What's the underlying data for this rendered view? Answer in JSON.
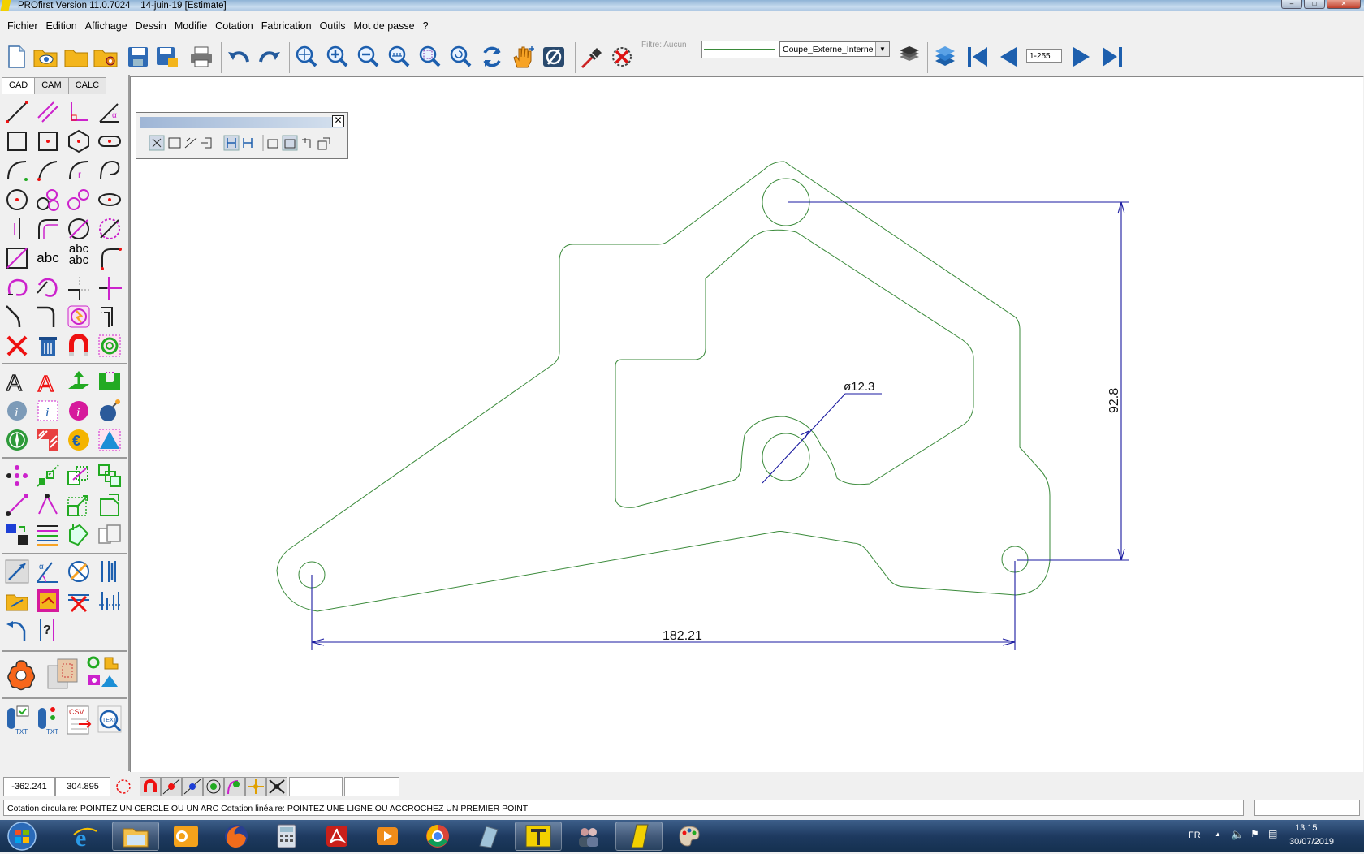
{
  "titlebar": {
    "app": "PROfirst Version 11.0.7024",
    "date": "14-juin-19 [Estimate]"
  },
  "menu": [
    "Fichier",
    "Edition",
    "Affichage",
    "Dessin",
    "Modifie",
    "Cotation",
    "Fabrication",
    "Outils",
    "Mot de passe",
    "?"
  ],
  "toolbar": {
    "filter_label": "Filtre: Aucun",
    "layer_select": "Coupe_Externe_Interne",
    "page_range": "1-255"
  },
  "tabs": [
    "CAD",
    "CAM",
    "CALC"
  ],
  "left_tool_labels": {
    "text1": "abc",
    "text2": "abc",
    "text3": "abc",
    "csv": "CSV",
    "txt1": "TXT",
    "txt2": "TXT",
    "text_search": "TEXT"
  },
  "drawing": {
    "dim_diameter": "ø12.3",
    "dim_vertical": "92.8",
    "dim_horizontal": "182.21",
    "part_color": "#3a8a3a",
    "dimension_color": "#1a1aa0"
  },
  "coords": {
    "x": "-362.241",
    "y": "304.895"
  },
  "status": {
    "message": "Cotation circulaire: POINTEZ UN CERCLE OU UN ARC  Cotation linéaire: POINTEZ UNE LIGNE OU ACCROCHEZ UN  PREMIER POINT"
  },
  "taskbar": {
    "lang": "FR",
    "time": "13:15",
    "date": "30/07/2019"
  }
}
